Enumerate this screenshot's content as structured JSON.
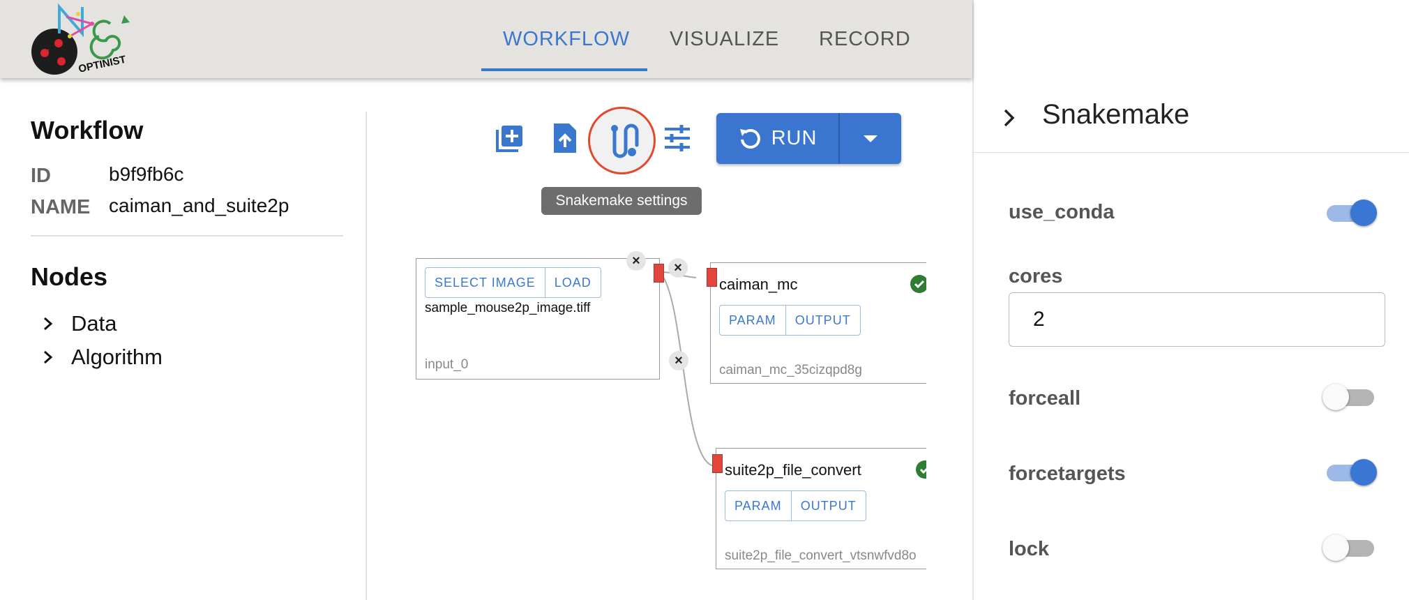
{
  "appbar": {
    "logo_text": "OPTINIST",
    "tabs": [
      {
        "label": "WORKFLOW",
        "active": true
      },
      {
        "label": "VISUALIZE",
        "active": false
      },
      {
        "label": "RECORD",
        "active": false
      }
    ]
  },
  "sidebar": {
    "workflow_heading": "Workflow",
    "id_key": "ID",
    "id_value": "b9f9fb6c",
    "name_key": "NAME",
    "name_value": "caiman_and_suite2p",
    "nodes_heading": "Nodes",
    "tree": [
      {
        "label": "Data"
      },
      {
        "label": "Algorithm"
      }
    ]
  },
  "toolbar": {
    "tooltip": "Snakemake settings",
    "run_label": "RUN",
    "accent_color": "#3a76cf",
    "highlight_color": "#e2482c"
  },
  "flow": {
    "input_node": {
      "select_label": "SELECT IMAGE",
      "load_label": "LOAD",
      "file": "sample_mouse2p_image.tiff",
      "id": "input_0"
    },
    "caiman_node": {
      "title": "caiman_mc",
      "param_label": "PARAM",
      "output_label": "OUTPUT",
      "id": "caiman_mc_35cizqpd8g"
    },
    "suite2p_node": {
      "title": "suite2p_file_convert",
      "param_label": "PARAM",
      "output_label": "OUTPUT",
      "id": "suite2p_file_convert_vtsnwfvd8o"
    },
    "delete_symbol": "×"
  },
  "panel": {
    "title": "Snakemake",
    "use_conda": {
      "label": "use_conda",
      "on": true
    },
    "cores": {
      "label": "cores",
      "value": "2"
    },
    "forceall": {
      "label": "forceall",
      "on": false
    },
    "forcetargets": {
      "label": "forcetargets",
      "on": true
    },
    "lock": {
      "label": "lock",
      "on": false
    }
  }
}
